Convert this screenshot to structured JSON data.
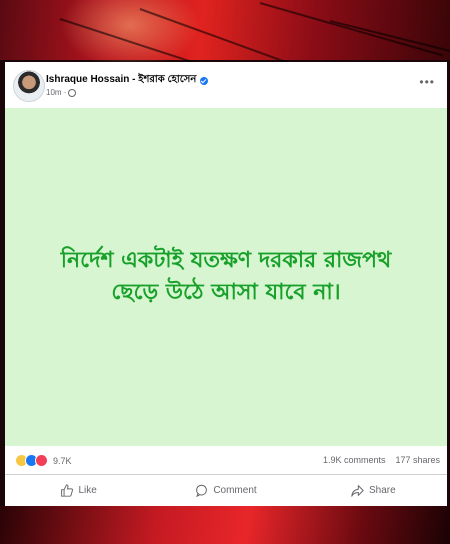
{
  "post": {
    "author": "Ishraque Hossain - ইশরাক হোসেন",
    "time": "10m ·",
    "text_line1": "নির্দেশ একটাই যতক্ষণ দরকার রাজপথ",
    "text_line2": "ছেড়ে উঠে আসা যাবে না।",
    "background_color": "#d8f5d1",
    "text_color": "#17a12a"
  },
  "stats": {
    "reaction_count": "9.7K",
    "comments": "1.9K comments",
    "shares": "177 shares",
    "reaction_icons": [
      "haha-icon",
      "like-icon",
      "love-icon"
    ]
  },
  "actions": {
    "like": "Like",
    "comment": "Comment",
    "share": "Share"
  },
  "colors": {
    "accent": "#1877f2",
    "banner_red": "#e0231f"
  }
}
